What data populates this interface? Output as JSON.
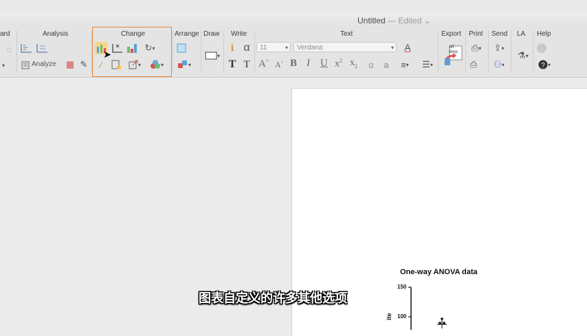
{
  "window": {
    "title": "Untitled",
    "status": "Edited"
  },
  "toolbar": {
    "groups": {
      "wizard": "ard",
      "analysis": "Analysis",
      "change": "Change",
      "arrange": "Arrange",
      "draw": "Draw",
      "write": "Write",
      "text": "Text",
      "export": "Export",
      "print": "Print",
      "send": "Send",
      "la": "LA",
      "help": "Help"
    },
    "analyze_label": "Analyze",
    "font_size": "11",
    "font_name": "Verdana",
    "export_badge": "tiff bmp"
  },
  "chart": {
    "title": "One-way ANOVA data",
    "yticks": [
      "150",
      "100"
    ],
    "ylabel_fragment": "ite"
  },
  "subtitle": "图表自定义的许多其他选项",
  "colors": {
    "highlight": "#e8853a"
  }
}
